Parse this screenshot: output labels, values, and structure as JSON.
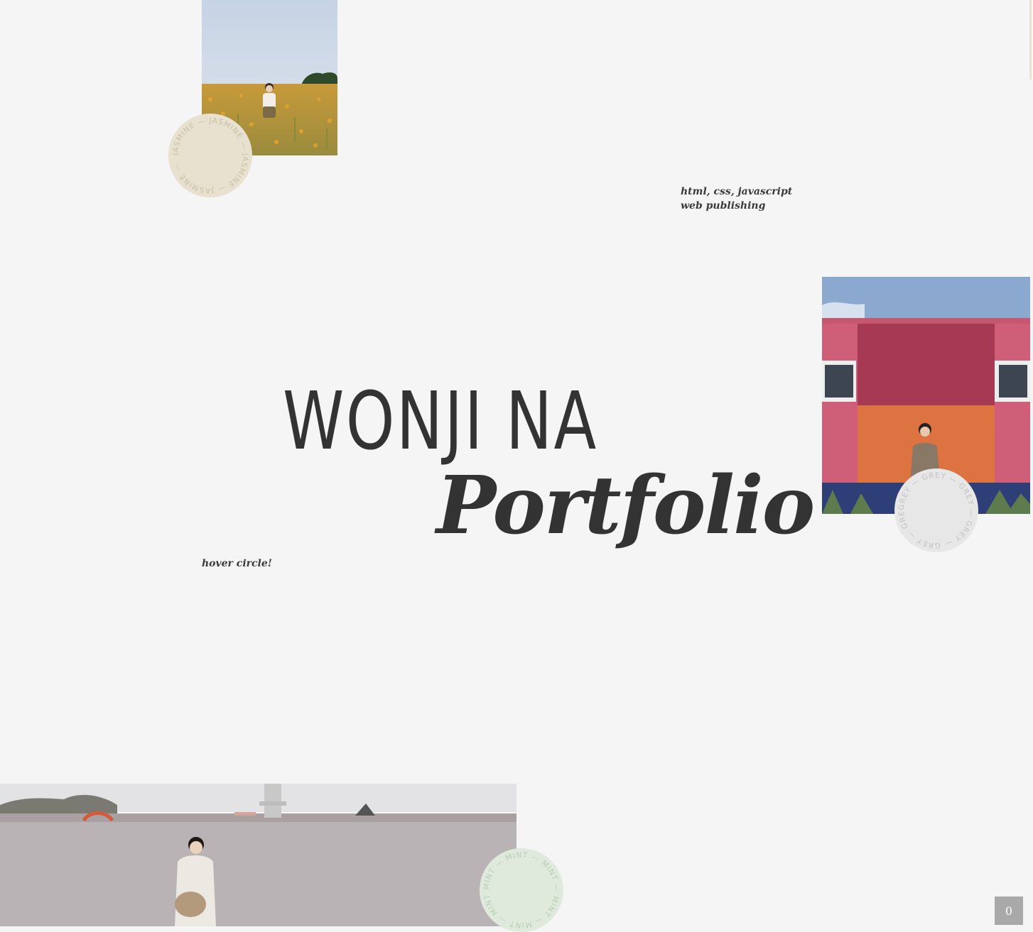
{
  "hero": {
    "skills": [
      "html, css, javascript",
      "web publishing"
    ],
    "name": "WONJI NA",
    "title": "Portfolio",
    "hint": "hover circle!"
  },
  "badges": {
    "jasmine": {
      "label": "JASMINE",
      "ring_text": "JASMINE — JASMINE — JASMINE — JASMINE — ",
      "color": "#e8e1d0",
      "text_color": "#c9bfa6"
    },
    "grey": {
      "label": "GREY",
      "ring_text": "GREY — GREY — GREY — GREY — GREY — GREY — ",
      "color": "#e7e7e7",
      "text_color": "#c2c2c2"
    },
    "mint": {
      "label": "MINT",
      "ring_text": "MINT — MINT — MINT — MINT — MINT — MINT — ",
      "color": "#dfeadd",
      "text_color": "#b8cdb6"
    }
  },
  "photos": {
    "flower_field": {
      "alt": "person sitting in a field of yellow flowers",
      "icon": "photo-flower-field"
    },
    "pink_wall": {
      "alt": "person standing in front of pink and orange building",
      "icon": "photo-pink-wall"
    },
    "seaside": {
      "alt": "person at the seaside with bag",
      "icon": "photo-seaside"
    }
  },
  "scroll_top_button": {
    "label": "0"
  },
  "colors": {
    "background": "#f5f5f5",
    "text": "#333333"
  }
}
